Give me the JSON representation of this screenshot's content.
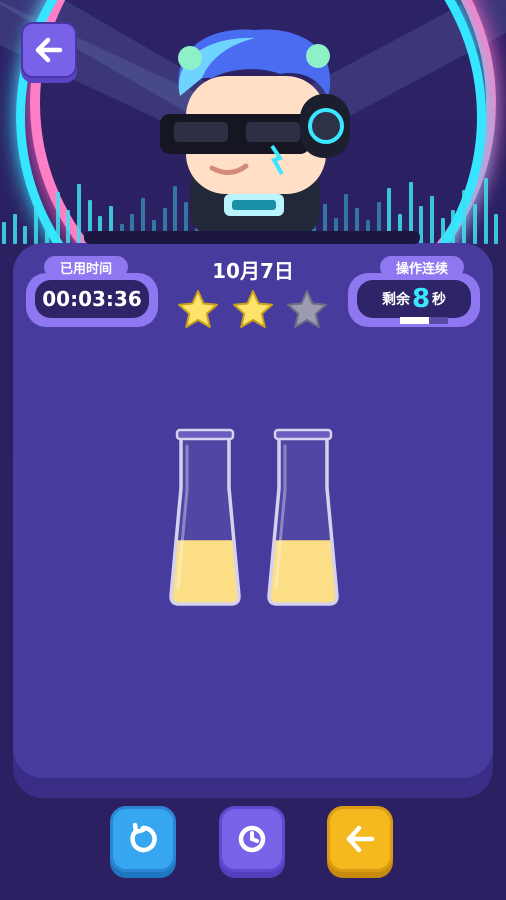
{
  "header": {
    "date": "10月7日",
    "stars_earned": 2,
    "stars_total": 3
  },
  "timer": {
    "label": "已用时间",
    "value": "00:03:36"
  },
  "combo": {
    "label": "操作连续",
    "prefix": "剩余",
    "seconds": "8",
    "suffix": "秒",
    "progress": 0.6
  },
  "tubes": [
    {
      "fill_level": 0.55,
      "color": "#fbdc7f"
    },
    {
      "fill_level": 0.55,
      "color": "#fbdc7f"
    }
  ],
  "controls": {
    "back_icon": "arrow-left-icon",
    "undo_icon": "undo-icon",
    "timer_icon": "clock-icon",
    "exit_icon": "arrow-left-icon"
  },
  "colors": {
    "accent_blue": "#36a6f0",
    "accent_purple": "#7a62e8",
    "accent_yellow": "#f5b920",
    "liquid": "#fbdc7f",
    "star_on": "#fde36a",
    "star_off": "#9c9bb0"
  }
}
